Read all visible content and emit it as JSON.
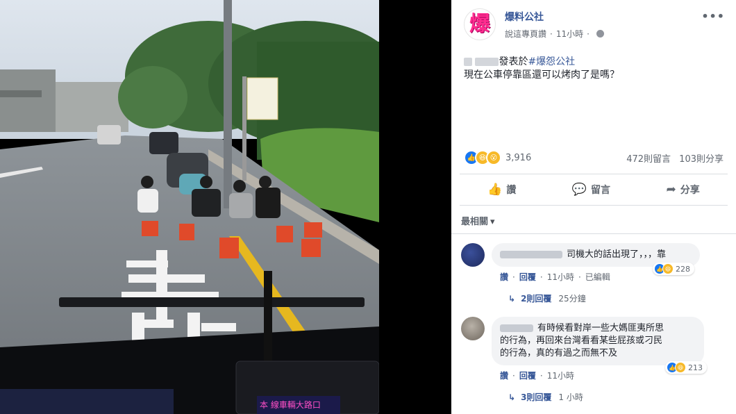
{
  "page": {
    "name": "爆料公社",
    "logo_text": "爆",
    "actions": [
      {
        "label": "讚",
        "icon": "thumbs-up-icon"
      },
      {
        "label": "留言",
        "icon": "comment-icon"
      },
      {
        "label": "分享",
        "icon": "share-icon"
      }
    ]
  },
  "post": {
    "subtitle": "說這專頁讚",
    "time": "11小時",
    "posted_in": "發表於",
    "hashtag": "#爆怨公社",
    "text": "現在公車停靠區還可以烤肉了是嗎？",
    "reaction_count": "3,916",
    "comment_count": "472則留言",
    "share_count": "103則分享"
  },
  "photo": {
    "road_marking": "靠",
    "sign_text": "本 線車輛大路口"
  },
  "comments": {
    "sort_label": "最相關",
    "items": [
      {
        "text": "司機大的話出現了，，，靠",
        "reactions": "228",
        "like_label": "讚",
        "reply_label": "回覆",
        "time": "11小時",
        "edited": "已編輯",
        "replies_label": "2則回覆",
        "replies_time": "25分鐘"
      },
      {
        "text_lines": [
          "有時候看對岸一些大媽匪夷所思",
          "的行為，再回來台灣看看某些屁孩或刁民",
          "的行為，真的有過之而無不及"
        ],
        "reactions": "213",
        "like_label": "讚",
        "reply_label": "回覆",
        "time": "11小時",
        "replies_label": "3則回覆",
        "replies_time": "1 小時"
      }
    ]
  },
  "colors": {
    "brand": "#385898",
    "logo": "#ff2d8f",
    "like": "#1877f2",
    "haha": "#f7b928"
  }
}
